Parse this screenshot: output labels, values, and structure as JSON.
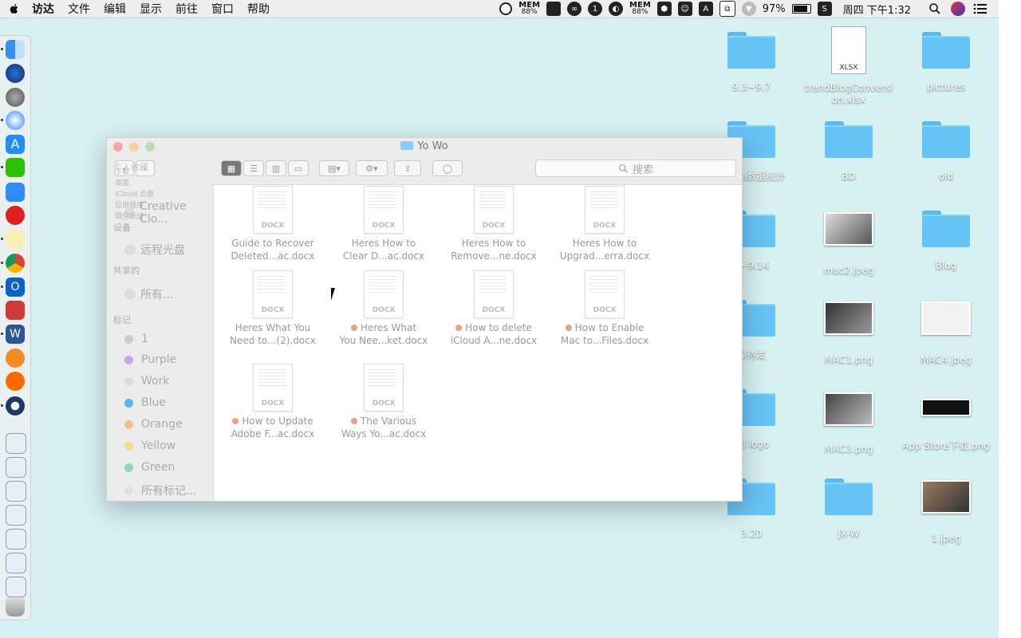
{
  "menubar": {
    "app": "访达",
    "items": [
      "文件",
      "编辑",
      "显示",
      "前往",
      "窗口",
      "帮助"
    ],
    "mem1": {
      "label": "MEM",
      "value": "88%"
    },
    "mem2": {
      "label": "MEM",
      "value": "88%"
    },
    "battery": "97%",
    "clock": "周四 下午1:32"
  },
  "window": {
    "title": "Yo Wo",
    "search_placeholder": "搜索",
    "sidebar": {
      "section_favorites": "个人收藏",
      "favorites": [
        "下载",
        "桌面",
        "iCloud 云盘",
        "应用程序",
        "隔空投送",
        "Creative Clo..."
      ],
      "section_devices": "设备",
      "devices": [
        "远程光盘"
      ],
      "section_shared": "共享的",
      "shared": [
        "所有..."
      ],
      "section_tags": "标记",
      "tags": [
        {
          "label": "1",
          "color": "#cccccc"
        },
        {
          "label": "Purple",
          "color": "#c9a6e0"
        },
        {
          "label": "Work",
          "color": "#dddddd"
        },
        {
          "label": "Blue",
          "color": "#55b6f0"
        },
        {
          "label": "Orange",
          "color": "#f3c08c"
        },
        {
          "label": "Yellow",
          "color": "#f4dc8e"
        },
        {
          "label": "Green",
          "color": "#8fd6b8"
        },
        {
          "label": "所有标记...",
          "color": "#e0e0e0"
        }
      ]
    },
    "files": [
      {
        "line1": "Guide to Recover",
        "line2": "Deleted...ac.docx",
        "tag": false
      },
      {
        "line1": "Heres How to",
        "line2": "Clear D...ac.docx",
        "tag": false
      },
      {
        "line1": "Heres How to",
        "line2": "Remove...ne.docx",
        "tag": false
      },
      {
        "line1": "Heres How to",
        "line2": "Upgrad...erra.docx",
        "tag": false
      },
      {
        "line1": "Heres What You",
        "line2": "Need to...(2).docx",
        "tag": false
      },
      {
        "line1": "Heres What",
        "line2": "You Nee...ket.docx",
        "tag": true
      },
      {
        "line1": "How to delete",
        "line2": "iCloud A...ne.docx",
        "tag": true
      },
      {
        "line1": "How to Enable",
        "line2": "Mac to...Files.docx",
        "tag": true
      },
      {
        "line1": "How to Update",
        "line2": "Adobe F...ac.docx",
        "tag": true
      },
      {
        "line1": "The Various",
        "line2": "Ways Yo...ac.docx",
        "tag": true
      }
    ],
    "doc_ext": "DOCX"
  },
  "desktop": [
    {
      "label": "9.3~9.7",
      "kind": "folder"
    },
    {
      "label": "trendBlogConversion.xlsx",
      "kind": "xlsx",
      "badge": "XLSX"
    },
    {
      "label": "pictures",
      "kind": "folder"
    },
    {
      "label": "media数据统计",
      "kind": "folder"
    },
    {
      "label": "BD",
      "kind": "folder"
    },
    {
      "label": "old",
      "kind": "folder"
    },
    {
      "label": "0~9.14",
      "kind": "folder"
    },
    {
      "label": "mac2.jpeg",
      "kind": "photo"
    },
    {
      "label": "Blog",
      "kind": "folder"
    },
    {
      "label": "异待发",
      "kind": "folder"
    },
    {
      "label": "MAC1.png",
      "kind": "photo"
    },
    {
      "label": "MAC4.jpeg",
      "kind": "photo"
    },
    {
      "label": "nd logo",
      "kind": "folder"
    },
    {
      "label": "MAC3.png",
      "kind": "photo"
    },
    {
      "label": "App Store下载.png",
      "kind": "photo"
    },
    {
      "label": "3.20",
      "kind": "folder"
    },
    {
      "label": "JX-W",
      "kind": "folder"
    },
    {
      "label": "1.jpeg",
      "kind": "photo"
    }
  ],
  "icons": {
    "apple": "apple-icon",
    "search": "search-icon",
    "finder": "finder-icon",
    "trash": "trash-icon"
  },
  "colors": {
    "desktop": "#d5f1f0",
    "folder": "#66c3f5",
    "menubar": "#eeeeee"
  }
}
